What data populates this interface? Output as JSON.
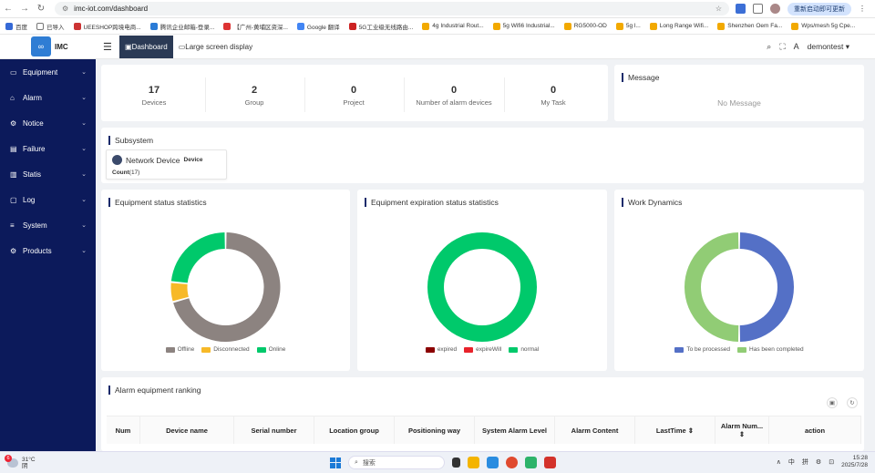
{
  "browser": {
    "url": "imc-iot.com/dashboard",
    "update_label": "重新启动即可更新",
    "bookmarks": [
      "百度",
      "已导入",
      "UEESHOP跨境电商...",
      "腾讯企业邮箱-登录...",
      "【广州-黄埔区资深...",
      "Google 翻译",
      "5G工业级无线路由...",
      "4g Industrial Rout...",
      "5g Wifi6 Industrial...",
      "RG5000-OD",
      "5g l...",
      "Long Range Wifi...",
      "Shenzhen Oem Fa...",
      "Wps/mesh 5g Cpe..."
    ]
  },
  "header": {
    "logo_text": "IMC",
    "tab_dashboard": "Dashboard",
    "tab_large": "Large screen display",
    "user": "demontest"
  },
  "sidebar": {
    "items": [
      {
        "label": "Equipment",
        "icon": "monitor-icon"
      },
      {
        "label": "Alarm",
        "icon": "home-icon"
      },
      {
        "label": "Notice",
        "icon": "gear-icon"
      },
      {
        "label": "Failure",
        "icon": "document-icon"
      },
      {
        "label": "Statis",
        "icon": "bar-chart-icon"
      },
      {
        "label": "Log",
        "icon": "log-icon"
      },
      {
        "label": "System",
        "icon": "list-icon"
      },
      {
        "label": "Products",
        "icon": "gear-icon"
      }
    ]
  },
  "stats": [
    {
      "value": "17",
      "label": "Devices"
    },
    {
      "value": "2",
      "label": "Group"
    },
    {
      "value": "0",
      "label": "Project"
    },
    {
      "value": "0",
      "label": "Number of alarm devices"
    },
    {
      "value": "0",
      "label": "My Task"
    }
  ],
  "message": {
    "title": "Message",
    "empty": "No Message"
  },
  "subsystem": {
    "title": "Subsystem",
    "name": "Network Device",
    "type": "Device",
    "count_label": "Count",
    "count_value": "(17)"
  },
  "colors": {
    "sidebar": "#0c1a5b",
    "offline": "#8c8380",
    "disconnected": "#f7b928",
    "online": "#00c96b",
    "expired": "#8b0000",
    "expireWill": "#e8232b",
    "normal": "#00c96b",
    "to_be_processed": "#5470c6",
    "completed": "#91cc75"
  },
  "charts": {
    "status_title": "Equipment status statistics",
    "expiration_title": "Equipment expiration status statistics",
    "work_title": "Work Dynamics"
  },
  "chart_data": [
    {
      "type": "pie",
      "title": "Equipment status statistics",
      "categories": [
        "Offline",
        "Disconnected",
        "Online"
      ],
      "values": [
        12,
        1,
        4
      ]
    },
    {
      "type": "pie",
      "title": "Equipment expiration status statistics",
      "categories": [
        "expired",
        "expireWill",
        "normal"
      ],
      "values": [
        0,
        0,
        17
      ]
    },
    {
      "type": "pie",
      "title": "Work Dynamics",
      "categories": [
        "To be processed",
        "Has been completed"
      ],
      "values": [
        1,
        1
      ]
    }
  ],
  "ranking": {
    "title": "Alarm equipment ranking",
    "columns": [
      "Num",
      "Device name",
      "Serial number",
      "Location group",
      "Positioning way",
      "System Alarm Level",
      "Alarm Content",
      "LastTime",
      "Alarm Num...",
      "action"
    ]
  },
  "taskbar": {
    "temp": "31°C",
    "weather": "阴",
    "badge": "6",
    "search": "搜索",
    "ime1": "中",
    "ime2": "拼",
    "time": "15:28",
    "date": "2025/7/28"
  }
}
